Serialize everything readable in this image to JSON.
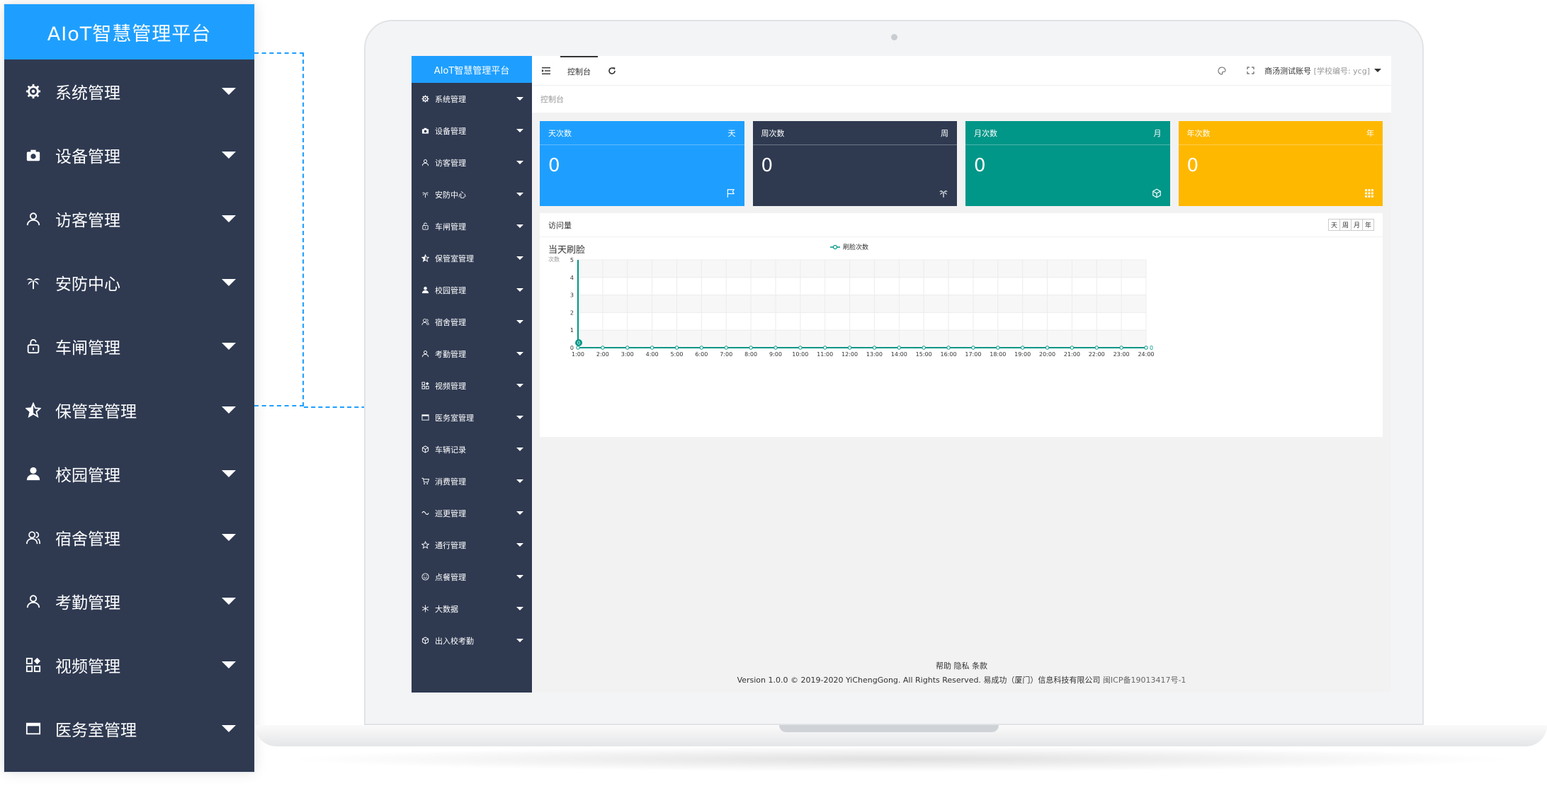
{
  "app": {
    "title": "AIoT智慧管理平台"
  },
  "zoom_sidebar": {
    "title": "AIoT智慧管理平台",
    "items": [
      {
        "label": "系统管理",
        "icon": "gear-icon"
      },
      {
        "label": "设备管理",
        "icon": "camera-icon"
      },
      {
        "label": "访客管理",
        "icon": "user-icon"
      },
      {
        "label": "安防中心",
        "icon": "palm-tree-icon"
      },
      {
        "label": "车闸管理",
        "icon": "lock-icon"
      },
      {
        "label": "保管室管理",
        "icon": "star-half-icon"
      },
      {
        "label": "校园管理",
        "icon": "user-solid-icon"
      },
      {
        "label": "宿舍管理",
        "icon": "users-icon"
      },
      {
        "label": "考勤管理",
        "icon": "user-icon"
      },
      {
        "label": "视频管理",
        "icon": "apps-icon"
      },
      {
        "label": "医务室管理",
        "icon": "card-icon"
      }
    ]
  },
  "sidebar": {
    "brand": "AIoT智慧管理平台",
    "items": [
      {
        "label": "系统管理",
        "icon": "gear-icon"
      },
      {
        "label": "设备管理",
        "icon": "camera-icon"
      },
      {
        "label": "访客管理",
        "icon": "user-icon"
      },
      {
        "label": "安防中心",
        "icon": "palm-tree-icon"
      },
      {
        "label": "车闸管理",
        "icon": "lock-icon"
      },
      {
        "label": "保管室管理",
        "icon": "star-half-icon"
      },
      {
        "label": "校园管理",
        "icon": "user-solid-icon"
      },
      {
        "label": "宿舍管理",
        "icon": "users-icon"
      },
      {
        "label": "考勤管理",
        "icon": "user-icon"
      },
      {
        "label": "视频管理",
        "icon": "apps-icon"
      },
      {
        "label": "医务室管理",
        "icon": "card-icon"
      },
      {
        "label": "车辆记录",
        "icon": "cube-icon"
      },
      {
        "label": "消费管理",
        "icon": "cart-icon"
      },
      {
        "label": "巡更管理",
        "icon": "route-icon"
      },
      {
        "label": "通行管理",
        "icon": "star-icon"
      },
      {
        "label": "点餐管理",
        "icon": "smile-icon"
      },
      {
        "label": "大数据",
        "icon": "snowflake-icon"
      },
      {
        "label": "出入校考勤",
        "icon": "cube-icon"
      }
    ]
  },
  "topbar": {
    "tab_label": "控制台",
    "account_name": "商汤测试账号",
    "account_school": "[学校编号: ycg]"
  },
  "breadcrumb": "控制台",
  "cards": [
    {
      "title": "天次数",
      "tag": "天",
      "value": "0",
      "color": "#1e9fff",
      "icon": "flag-icon"
    },
    {
      "title": "周次数",
      "tag": "周",
      "value": "0",
      "color": "#2f3a51",
      "icon": "palm-tree-icon"
    },
    {
      "title": "月次数",
      "tag": "月",
      "value": "0",
      "color": "#009688",
      "icon": "cube-icon"
    },
    {
      "title": "年次数",
      "tag": "年",
      "value": "0",
      "color": "#ffb800",
      "icon": "grid-icon"
    }
  ],
  "visits_panel": {
    "title": "访问量",
    "range_tabs": [
      "天",
      "周",
      "月",
      "年"
    ]
  },
  "chart_data": {
    "type": "line",
    "title": "当天刷脸",
    "ylabel": "次数",
    "x": [
      "1:00",
      "2:00",
      "3:00",
      "4:00",
      "5:00",
      "6:00",
      "7:00",
      "8:00",
      "9:00",
      "10:00",
      "11:00",
      "12:00",
      "13:00",
      "14:00",
      "15:00",
      "16:00",
      "17:00",
      "18:00",
      "19:00",
      "20:00",
      "21:00",
      "22:00",
      "23:00",
      "24:00"
    ],
    "series": [
      {
        "name": "刷脸次数",
        "values": [
          0,
          0,
          0,
          0,
          0,
          0,
          0,
          0,
          0,
          0,
          0,
          0,
          0,
          0,
          0,
          0,
          0,
          0,
          0,
          0,
          0,
          0,
          0,
          0
        ]
      }
    ],
    "ylim": [
      0,
      5
    ],
    "yticks": [
      0,
      1,
      2,
      3,
      4,
      5
    ],
    "first_point_label": "0",
    "last_point_label": "0",
    "grid": true,
    "legend": "top-center",
    "color": "#009688"
  },
  "footer": {
    "links": "帮助 隐私 条款",
    "copyright": "Version 1.0.0 © 2019-2020 YiChengGong. All Rights Reserved. 易成功（厦门）信息科技有限公司",
    "icp": "闽ICP备19013417号-1"
  }
}
